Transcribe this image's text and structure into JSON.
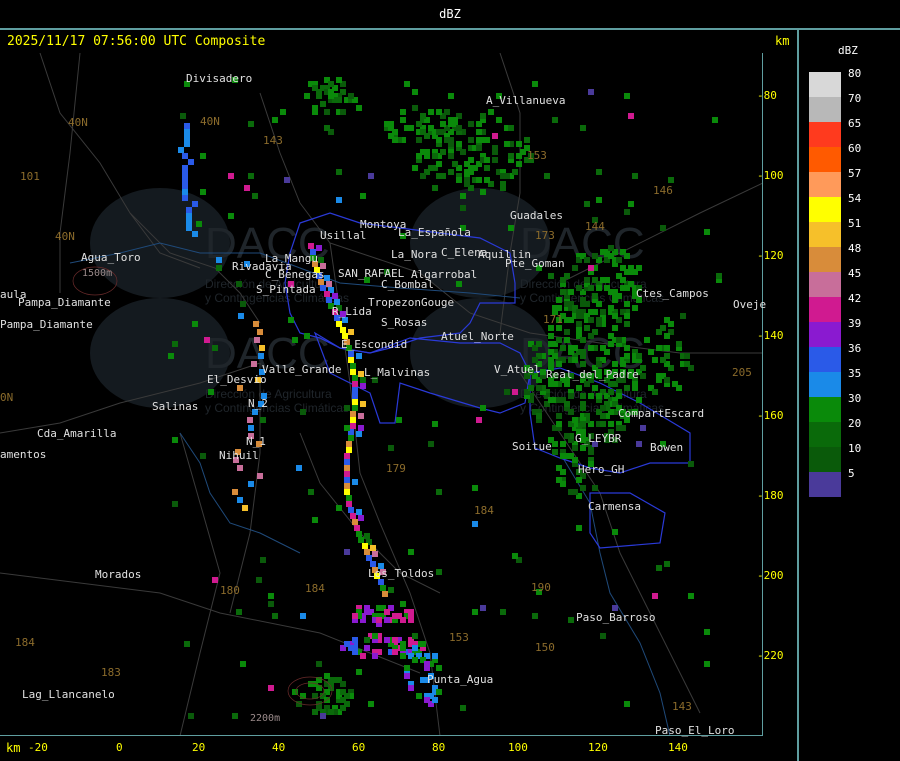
{
  "header": {
    "title": "dBZ"
  },
  "timestamp": "2025/11/17 07:56:00 UTC Composite",
  "axis_unit_top": "km",
  "axis_unit_bottom": "km",
  "y_ticks": [
    "-80",
    "-100",
    "-120",
    "-140",
    "-160",
    "-180",
    "-200",
    "-220"
  ],
  "x_ticks": [
    "-20",
    "0",
    "20",
    "40",
    "60",
    "80",
    "100",
    "120",
    "140"
  ],
  "legend": {
    "title": "dBZ",
    "items": [
      {
        "label": "80",
        "color": "#d8d8d8"
      },
      {
        "label": "70",
        "color": "#b8b8b8"
      },
      {
        "label": "65",
        "color": "#ff3a1e"
      },
      {
        "label": "60",
        "color": "#ff5a00"
      },
      {
        "label": "57",
        "color": "#ff9a5a"
      },
      {
        "label": "54",
        "color": "#ffff00"
      },
      {
        "label": "51",
        "color": "#f6c02a"
      },
      {
        "label": "48",
        "color": "#d88c3a"
      },
      {
        "label": "45",
        "color": "#c86e9a"
      },
      {
        "label": "42",
        "color": "#d01a90"
      },
      {
        "label": "39",
        "color": "#8a1ad0"
      },
      {
        "label": "36",
        "color": "#2a5ae8"
      },
      {
        "label": "35",
        "color": "#1a8ae8"
      },
      {
        "label": "30",
        "color": "#0a8a0a"
      },
      {
        "label": "20",
        "color": "#0a6a0a"
      },
      {
        "label": "10",
        "color": "#0a5a0a"
      },
      {
        "label": "5",
        "color": "#4a3a9a"
      }
    ]
  },
  "places": [
    {
      "id": "divisadero",
      "name": "Divisadero"
    },
    {
      "id": "a-villanueva",
      "name": "A_Villanueva"
    },
    {
      "id": "guadales",
      "name": "Guadales"
    },
    {
      "id": "montoya",
      "name": "Montoya"
    },
    {
      "id": "usillal",
      "name": "Usillal"
    },
    {
      "id": "la-espanola",
      "name": "La_Española"
    },
    {
      "id": "la-nora",
      "name": "La_Nora"
    },
    {
      "id": "c-elena",
      "name": "C_Elena"
    },
    {
      "id": "aquillin",
      "name": "Aquillin"
    },
    {
      "id": "aguan",
      "name": "Pte_Goman"
    },
    {
      "id": "agua-toro",
      "name": "Agua_Toro"
    },
    {
      "id": "rivadavia",
      "name": "Rivadavia"
    },
    {
      "id": "e-nuevo",
      "name": "La_Mangu"
    },
    {
      "id": "c-benegas",
      "name": "C_Benegas"
    },
    {
      "id": "san-rafael",
      "name": "SAN_RAFAEL"
    },
    {
      "id": "algarrobal",
      "name": "Algarrobal"
    },
    {
      "id": "c-bombal",
      "name": "C_Bombal"
    },
    {
      "id": "aula",
      "name": "aula"
    },
    {
      "id": "pampa-diamante",
      "name": "Pampa_Diamante"
    },
    {
      "id": "s-pintada",
      "name": "S_Pintada"
    },
    {
      "id": "tropezon",
      "name": "Tropezon"
    },
    {
      "id": "gouge",
      "name": "Gouge"
    },
    {
      "id": "c-goudge",
      "name": "Ctes_Campos"
    },
    {
      "id": "oveje",
      "name": "Oveje"
    },
    {
      "id": "r-lida",
      "name": "R_Lida"
    },
    {
      "id": "s-rosas",
      "name": "S_Rosas"
    },
    {
      "id": "atuel-norte",
      "name": "Atuel_Norte"
    },
    {
      "id": "e-escondido",
      "name": "E_Escondid"
    },
    {
      "id": "el-desvio",
      "name": "El_Desvio"
    },
    {
      "id": "valle-grande",
      "name": "Valle_Grande"
    },
    {
      "id": "l-malvinas",
      "name": "L_Malvinas"
    },
    {
      "id": "v-atuel",
      "name": "V_Atuel"
    },
    {
      "id": "real-del-padre",
      "name": "Real_del_Padre"
    },
    {
      "id": "salinas",
      "name": "Salinas"
    },
    {
      "id": "n-2",
      "name": "N_2"
    },
    {
      "id": "cda-amarilla",
      "name": "Cda_Amarilla"
    },
    {
      "id": "n-1",
      "name": "N_1"
    },
    {
      "id": "nihuil",
      "name": "Nihuil"
    },
    {
      "id": "amentos",
      "name": "amentos"
    },
    {
      "id": "soitue",
      "name": "Soitue"
    },
    {
      "id": "compartescard",
      "name": "CompartEscard"
    },
    {
      "id": "g-levar",
      "name": "G_LEYBR"
    },
    {
      "id": "bowen",
      "name": "Bowen"
    },
    {
      "id": "hero-gh",
      "name": "Hero_GH"
    },
    {
      "id": "carmensa",
      "name": "Carmensa"
    },
    {
      "id": "morados",
      "name": "Morados"
    },
    {
      "id": "los-toldos",
      "name": "Los_Toldos"
    },
    {
      "id": "paso-barroso",
      "name": "Paso_Barroso"
    },
    {
      "id": "punta-agua",
      "name": "Punta_Agua"
    },
    {
      "id": "lag-llancanelo",
      "name": "Lag_Llancanelo"
    },
    {
      "id": "paso-el-loro",
      "name": "Paso_El_Loro"
    },
    {
      "id": "v-amarillo",
      "name": "Pampa_Diamante"
    }
  ],
  "terrain_labels": [
    "1500m",
    "2200m"
  ],
  "watermark": {
    "text": "DACC",
    "subtitle1": "Dirección de Agricultura",
    "subtitle2": "y Contingencias Climáticas"
  },
  "route_numbers": [
    "101",
    "40N",
    "40N",
    "143",
    "153",
    "146",
    "144",
    "173",
    "171",
    "205",
    "179",
    "184",
    "180",
    "184",
    "183",
    "153",
    "150",
    "143",
    "184",
    "190",
    "40N",
    "0N"
  ]
}
